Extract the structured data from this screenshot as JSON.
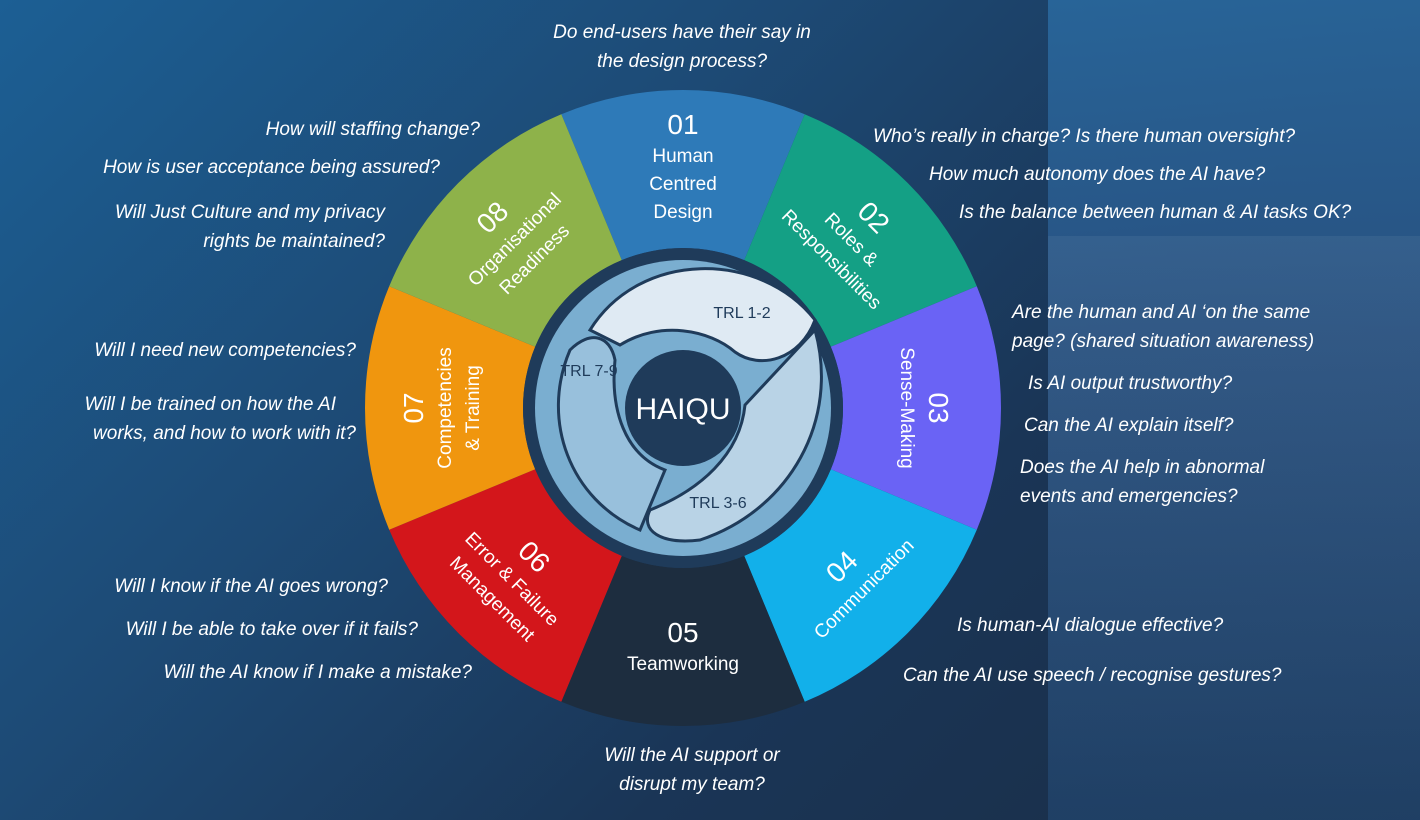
{
  "center": {
    "title": "HAIQU"
  },
  "trl": [
    {
      "label": "TRL 1-2"
    },
    {
      "label": "TRL 3-6"
    },
    {
      "label": "TRL 7-9"
    }
  ],
  "segments": [
    {
      "num": "01",
      "lines": [
        "Human",
        "Centred",
        "Design"
      ],
      "color": "#2e7ab8"
    },
    {
      "num": "02",
      "lines": [
        "Roles &",
        "Responsibilities"
      ],
      "color": "#14a085"
    },
    {
      "num": "03",
      "lines": [
        "Sense-Making"
      ],
      "color": "#6a63f5"
    },
    {
      "num": "04",
      "lines": [
        "Communication"
      ],
      "color": "#12b0ea"
    },
    {
      "num": "05",
      "lines": [
        "Teamworking"
      ],
      "color": "#1d2d3f"
    },
    {
      "num": "06",
      "lines": [
        "Error & Failure",
        "Management"
      ],
      "color": "#d3161b"
    },
    {
      "num": "07",
      "lines": [
        "Competencies",
        "& Training"
      ],
      "color": "#f0960e"
    },
    {
      "num": "08",
      "lines": [
        "Organisational",
        "Readiness"
      ],
      "color": "#8eb24a"
    }
  ],
  "questions": {
    "top": [
      "Do end-users have their say in",
      "the design process?"
    ],
    "q08": [
      "How will staffing change?",
      "How is user acceptance being assured?",
      "Will Just Culture and my privacy",
      "rights be maintained?"
    ],
    "q02": [
      "Who’s really in charge? Is there human oversight?",
      "How much autonomy does the AI have?",
      "Is the balance between human & AI tasks OK?"
    ],
    "q07": [
      "Will I need new competencies?",
      "Will I be trained on how the AI",
      "works, and how to work with it?"
    ],
    "q03": [
      "Are the human and AI ‘on the same",
      "page? (shared situation awareness)",
      "Is AI output trustworthy?",
      "Can the AI explain itself?",
      "Does the AI help in abnormal",
      "events and emergencies?"
    ],
    "q06": [
      "Will I know if the AI goes wrong?",
      "Will I be able to take over if it fails?",
      "Will the AI know if I make a mistake?"
    ],
    "q04": [
      "Is human-AI dialogue effective?",
      "Can the AI use speech / recognise gestures?"
    ],
    "q05": [
      "Will the AI support or",
      "disrupt my team?"
    ]
  }
}
